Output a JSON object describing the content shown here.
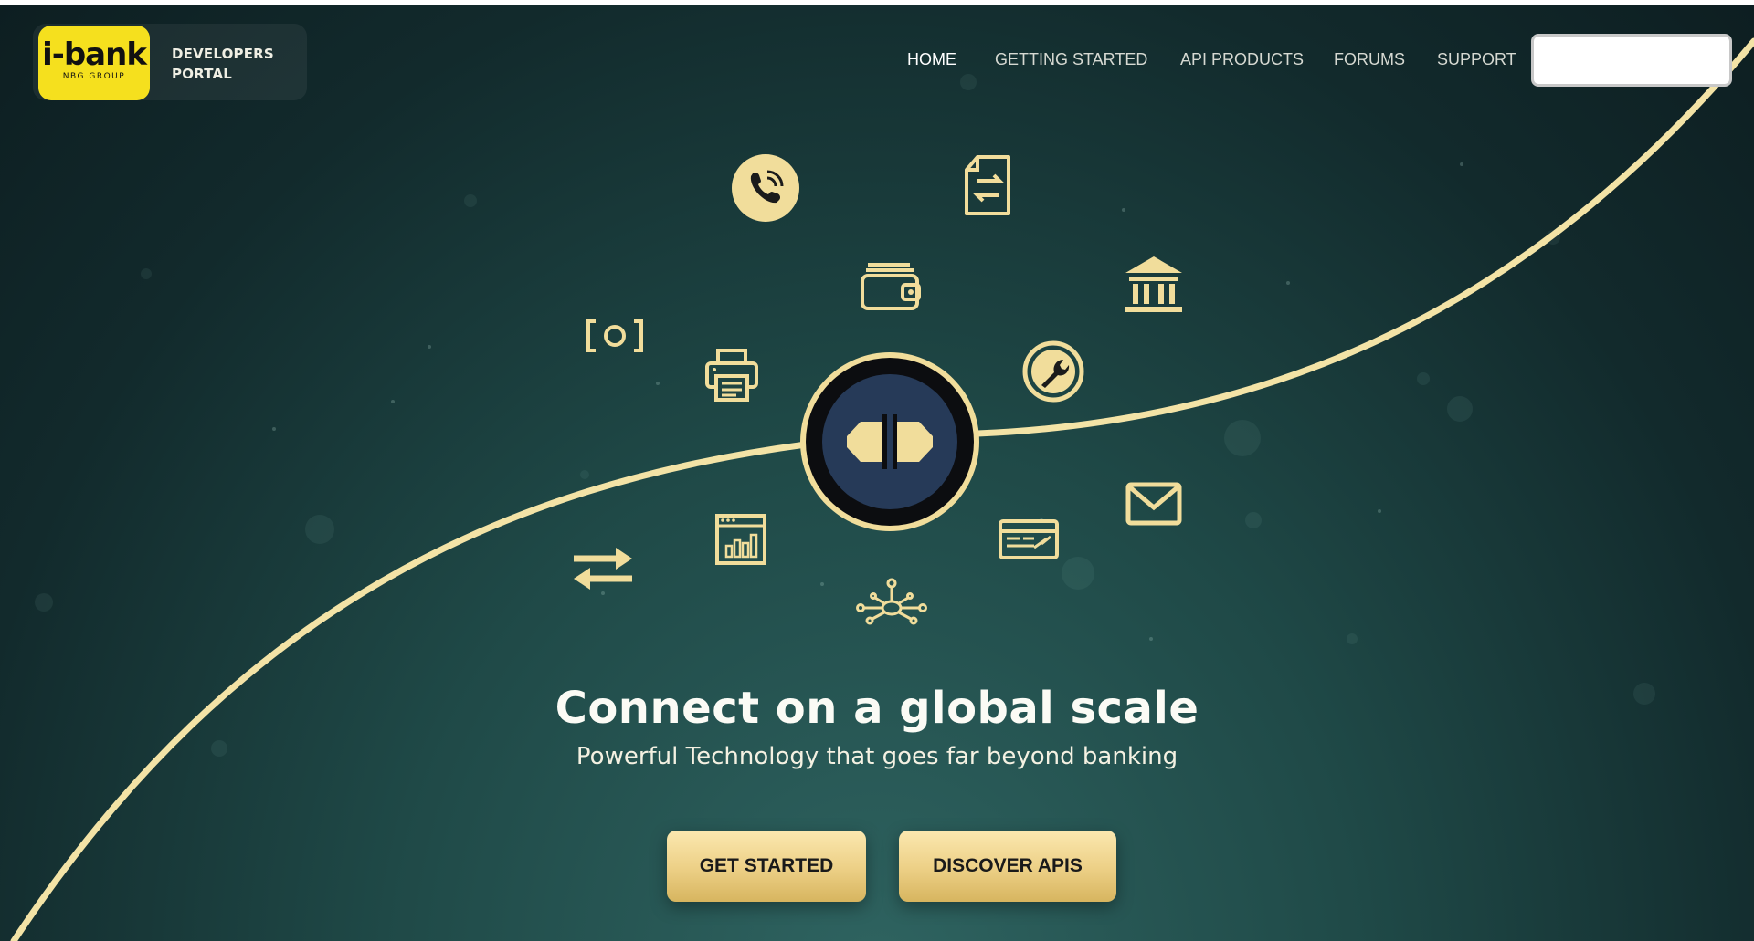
{
  "brand": {
    "logo_text": "i-bank",
    "logo_subtext": "NBG GROUP",
    "portal_line1": "DEVELOPERS",
    "portal_line2": "PORTAL"
  },
  "nav": {
    "items": [
      {
        "label": "HOME",
        "active": true
      },
      {
        "label": "GETTING STARTED",
        "active": false
      },
      {
        "label": "API PRODUCTS",
        "active": false
      },
      {
        "label": "FORUMS",
        "active": false
      },
      {
        "label": "SUPPORT",
        "active": false
      }
    ]
  },
  "search": {
    "value": "",
    "placeholder": ""
  },
  "hero": {
    "title": "Connect on a global scale",
    "subtitle": "Powerful Technology that goes far beyond banking",
    "primary_button": "GET STARTED",
    "secondary_button": "DISCOVER APIS"
  },
  "icons": {
    "center": "plug-connector-icon",
    "orbit": [
      "phone-icon",
      "document-exchange-icon",
      "wallet-icon",
      "bank-icon",
      "cash-icon",
      "printer-icon",
      "wrench-icon",
      "email-icon",
      "transfer-arrows-icon",
      "analytics-window-icon",
      "card-reader-icon",
      "network-hub-icon"
    ]
  },
  "colors": {
    "accent_gold": "#f1dd9b",
    "logo_yellow": "#f5e01e",
    "background_dark": "#0d1e21",
    "background_teal": "#2f6461"
  }
}
